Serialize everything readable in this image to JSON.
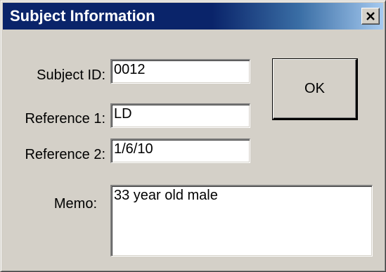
{
  "window": {
    "title": "Subject Information",
    "close_glyph": "close-icon"
  },
  "form": {
    "subject_id_label": "Subject ID:",
    "subject_id_value": "0012",
    "reference1_label": "Reference 1:",
    "reference1_value": "LD",
    "reference2_label": "Reference 2:",
    "reference2_value": "1/6/10",
    "memo_label": "Memo:",
    "memo_value": "33 year old male"
  },
  "buttons": {
    "ok_label": "OK"
  },
  "colors": {
    "titlebar_start": "#0a246a",
    "titlebar_end": "#a6caf0",
    "dialog_face": "#d4d0c8"
  }
}
